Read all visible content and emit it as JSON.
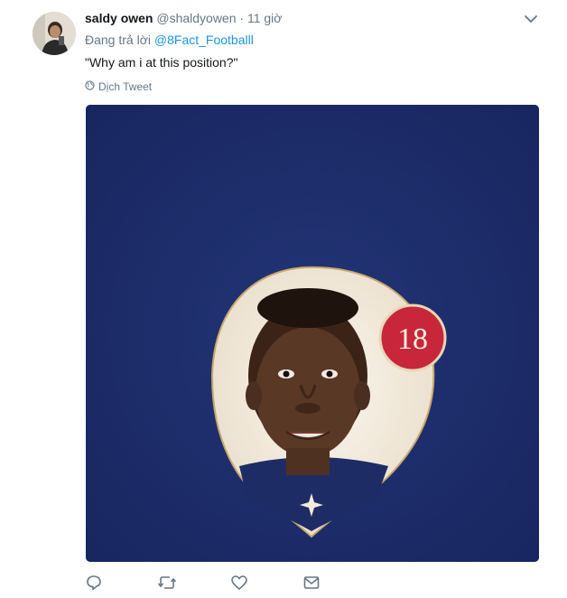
{
  "tweet": {
    "display_name": "saldy owen",
    "handle": "@shaldyowen",
    "separator": "·",
    "time": "11 giờ",
    "replying_prefix": "Đang trả lời",
    "replying_to": "@8Fact_Footballl",
    "text": "\"Why am i at this position?\"",
    "translate_label": "Dịch Tweet"
  },
  "media": {
    "badge_number": "18",
    "background_color": "#1d2d68",
    "badge_color": "#c8263a"
  },
  "actions": [
    "reply-icon",
    "retweet-icon",
    "like-icon",
    "direct-message-icon"
  ]
}
